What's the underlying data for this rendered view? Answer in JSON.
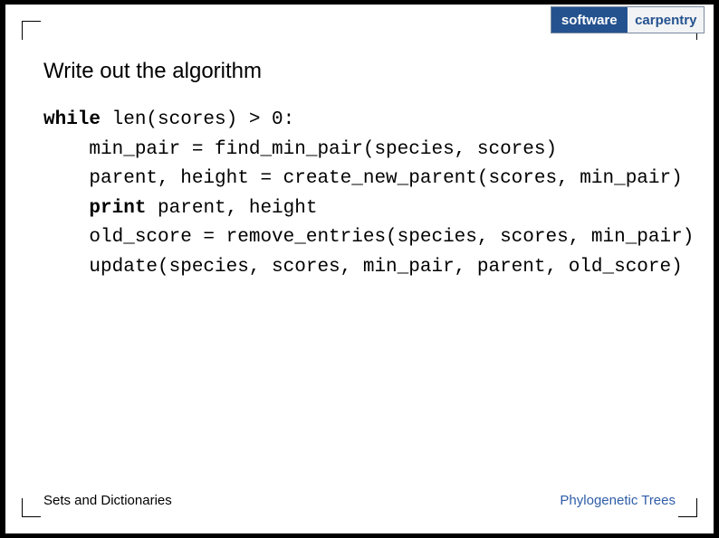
{
  "logo": {
    "left": "software",
    "right": "carpentry"
  },
  "title": "Write out the algorithm",
  "code": {
    "l1a": "while",
    "l1b": " len(scores) > 0:",
    "l2": "    min_pair = find_min_pair(species, scores)",
    "l3": "    parent, height = create_new_parent(scores, min_pair)",
    "l4a": "    ",
    "l4b": "print",
    "l4c": " parent, height",
    "l5": "    old_score = remove_entries(species, scores, min_pair)",
    "l6": "    update(species, scores, min_pair, parent, old_score)"
  },
  "footer": {
    "left": "Sets and Dictionaries",
    "right": "Phylogenetic Trees"
  }
}
